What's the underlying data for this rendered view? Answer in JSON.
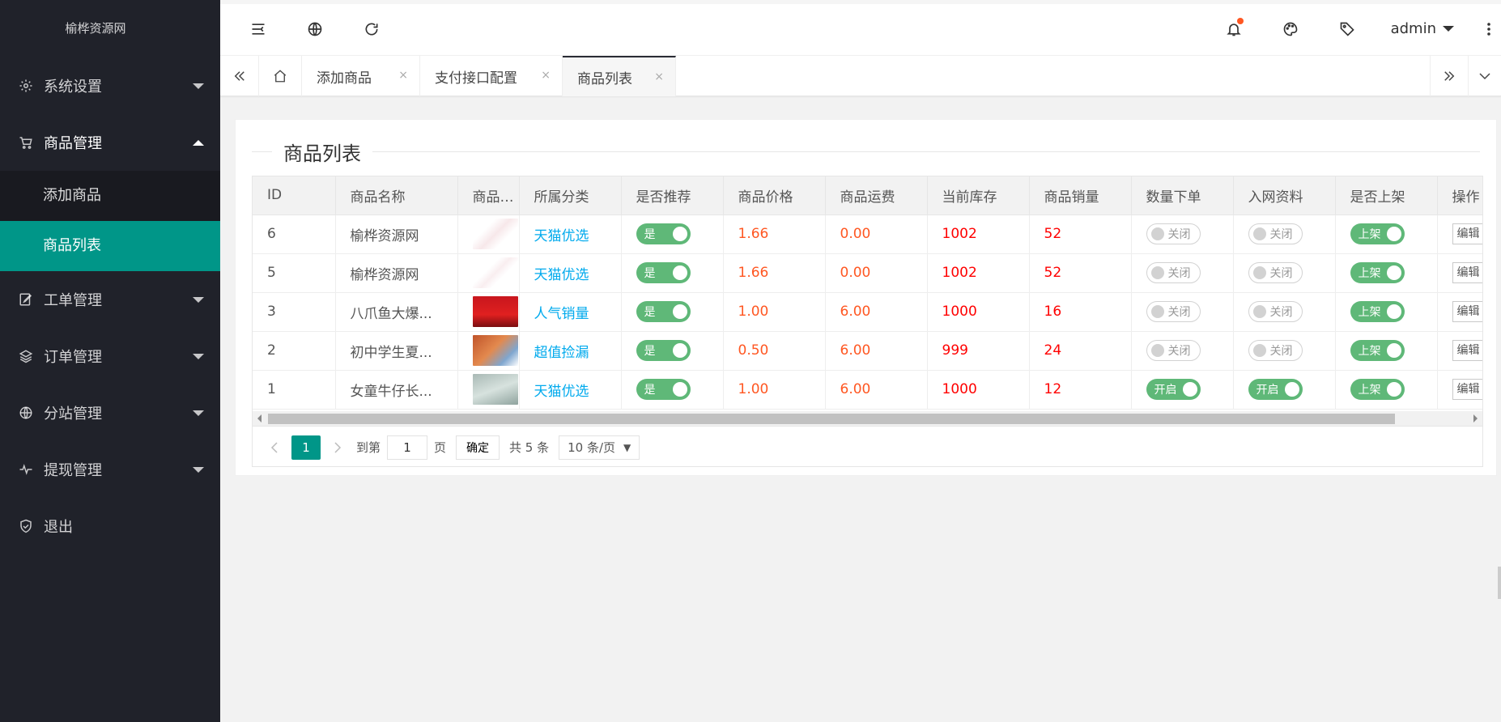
{
  "site": {
    "title": "榆桦资源网"
  },
  "sidebar": {
    "items": [
      {
        "label": "系统设置",
        "icon": "gear-icon"
      },
      {
        "label": "商品管理",
        "icon": "cart-icon",
        "expanded": true,
        "children": [
          {
            "label": "添加商品"
          },
          {
            "label": "商品列表",
            "active": true
          }
        ]
      },
      {
        "label": "工单管理",
        "icon": "edit-icon"
      },
      {
        "label": "订单管理",
        "icon": "layers-icon"
      },
      {
        "label": "分站管理",
        "icon": "globe-icon"
      },
      {
        "label": "提现管理",
        "icon": "pulse-icon"
      },
      {
        "label": "退出",
        "icon": "shield-check-icon"
      }
    ]
  },
  "header": {
    "user": "admin",
    "icons": [
      "menu-fold-icon",
      "globe-icon",
      "refresh-icon",
      "bell-icon",
      "palette-icon",
      "tag-icon",
      "more-vertical-icon"
    ]
  },
  "tabs": {
    "items": [
      {
        "label": "添加商品"
      },
      {
        "label": "支付接口配置"
      },
      {
        "label": "商品列表",
        "active": true
      }
    ],
    "close_glyph": "×"
  },
  "panel": {
    "title": "商品列表"
  },
  "table": {
    "headers": [
      "ID",
      "商品名称",
      "商品图片",
      "所属分类",
      "是否推荐",
      "商品价格",
      "商品运费",
      "当前库存",
      "商品销量",
      "数量下单",
      "入网资料",
      "是否上架",
      "操作"
    ],
    "rows": [
      {
        "id": "6",
        "name": "榆桦资源网",
        "category": "天猫优选",
        "recommend": "是",
        "price": "1.66",
        "freight": "0.00",
        "stock": "1002",
        "sales": "52",
        "qty_order": "关闭",
        "qty_on": false,
        "netinfo": "关闭",
        "net_on": false,
        "shelf": "上架",
        "action": "编辑"
      },
      {
        "id": "5",
        "name": "榆桦资源网",
        "category": "天猫优选",
        "recommend": "是",
        "price": "1.66",
        "freight": "0.00",
        "stock": "1002",
        "sales": "52",
        "qty_order": "关闭",
        "qty_on": false,
        "netinfo": "关闭",
        "net_on": false,
        "shelf": "上架",
        "action": "编辑"
      },
      {
        "id": "3",
        "name": "八爪鱼大爆...",
        "category": "人气销量",
        "recommend": "是",
        "price": "1.00",
        "freight": "6.00",
        "stock": "1000",
        "sales": "16",
        "qty_order": "关闭",
        "qty_on": false,
        "netinfo": "关闭",
        "net_on": false,
        "shelf": "上架",
        "action": "编辑"
      },
      {
        "id": "2",
        "name": "初中学生夏...",
        "category": "超值捡漏",
        "recommend": "是",
        "price": "0.50",
        "freight": "6.00",
        "stock": "999",
        "sales": "24",
        "qty_order": "关闭",
        "qty_on": false,
        "netinfo": "关闭",
        "net_on": false,
        "shelf": "上架",
        "action": "编辑"
      },
      {
        "id": "1",
        "name": "女童牛仔长...",
        "category": "天猫优选",
        "recommend": "是",
        "price": "1.00",
        "freight": "6.00",
        "stock": "1000",
        "sales": "12",
        "qty_order": "开启",
        "qty_on": true,
        "netinfo": "开启",
        "net_on": true,
        "shelf": "上架",
        "action": "编辑"
      }
    ]
  },
  "pager": {
    "current": "1",
    "goto_label": "到第",
    "goto_value": "1",
    "page_label": "页",
    "confirm": "确定",
    "total": "共 5 条",
    "page_size": "10 条/页"
  },
  "colors": {
    "accent": "#009688",
    "switch_on": "#5fb878",
    "price": "#ff5722",
    "stock": "#ff0000",
    "link": "#01aaed"
  }
}
